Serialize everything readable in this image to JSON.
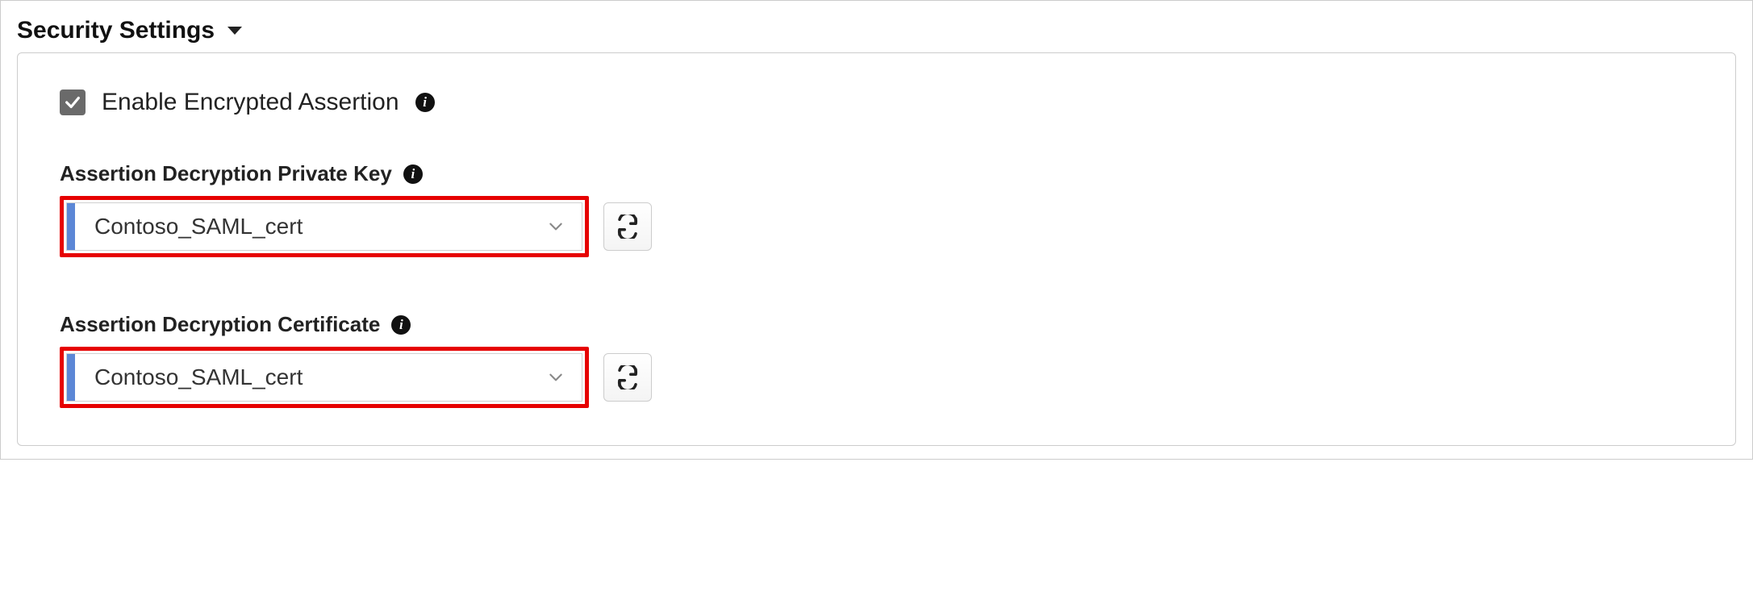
{
  "section": {
    "title": "Security Settings"
  },
  "checkbox": {
    "label": "Enable Encrypted Assertion",
    "checked": true
  },
  "fields": {
    "private_key": {
      "label": "Assertion Decryption Private Key",
      "value": "Contoso_SAML_cert"
    },
    "certificate": {
      "label": "Assertion Decryption Certificate",
      "value": "Contoso_SAML_cert"
    }
  },
  "colors": {
    "highlight_border": "#e60000",
    "select_accent": "#5c87d6",
    "checkbox_bg": "#6a6a6a"
  }
}
